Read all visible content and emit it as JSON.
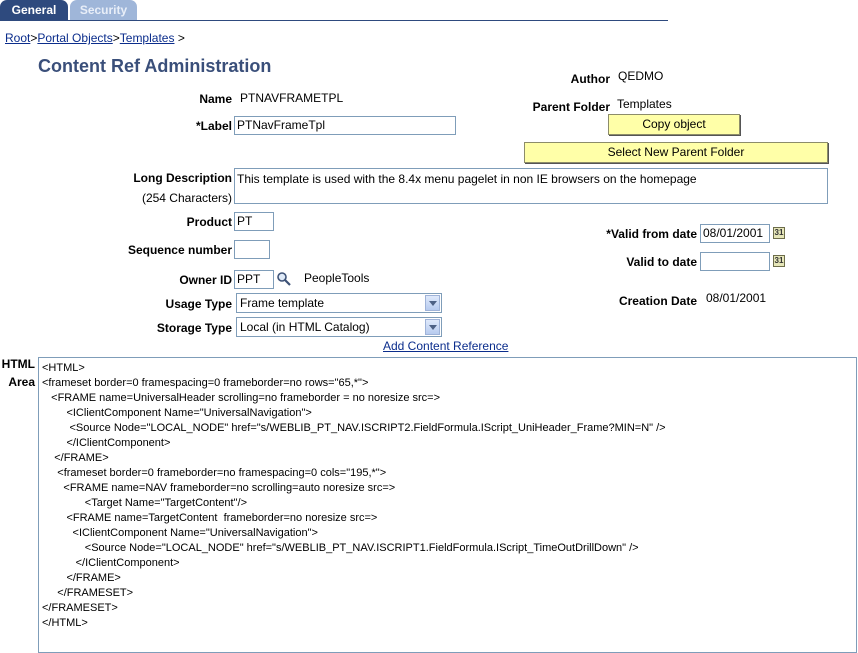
{
  "tabs": [
    {
      "label": "General",
      "active": true
    },
    {
      "label": "Security",
      "active": false
    }
  ],
  "breadcrumb": {
    "items": [
      "Root",
      "Portal Objects",
      "Templates"
    ],
    "separator": ">"
  },
  "page_title": "Content Ref Administration",
  "fields": {
    "name_label": "Name",
    "name_value": "PTNAVFRAMETPL",
    "label_label": "*Label",
    "label_value": "PTNavFrameTpl",
    "author_label": "Author",
    "author_value": "QEDMO",
    "parent_folder_label": "Parent Folder",
    "parent_folder_value": "Templates",
    "long_desc_label": "Long Description",
    "long_desc_hint": "(254 Characters)",
    "long_desc_value": "This template is used with the 8.4x menu pagelet in non IE browsers on the homepage",
    "product_label": "Product",
    "product_value": "PT",
    "sequence_label": "Sequence number",
    "sequence_value": "",
    "owner_label": "Owner ID",
    "owner_value": "PPT",
    "owner_desc": "PeopleTools",
    "usage_label": "Usage Type",
    "usage_value": "Frame template",
    "storage_label": "Storage Type",
    "storage_value": "Local (in HTML Catalog)",
    "valid_from_label": "*Valid from date",
    "valid_from_value": "08/01/2001",
    "valid_to_label": "Valid to date",
    "valid_to_value": "",
    "creation_label": "Creation Date",
    "creation_value": "08/01/2001",
    "html_label_1": "HTML",
    "html_label_2": "Area"
  },
  "buttons": {
    "copy_object": "Copy object",
    "select_parent": "Select New Parent Folder",
    "add_content_ref": "Add Content Reference"
  },
  "html_area_lines": [
    "<HTML>",
    "<frameset border=0 framespacing=0 frameborder=no rows=\"65,*\">",
    "   <FRAME name=UniversalHeader scrolling=no frameborder = no noresize src=>",
    "        <IClientComponent Name=\"UniversalNavigation\">",
    "         <Source Node=\"LOCAL_NODE\" href=\"s/WEBLIB_PT_NAV.ISCRIPT2.FieldFormula.IScript_UniHeader_Frame?MIN=N\" />",
    "        </IClientComponent>",
    "    </FRAME>",
    "     <frameset border=0 frameborder=no framespacing=0 cols=\"195,*\">",
    "       <FRAME name=NAV frameborder=no scrolling=auto noresize src=>",
    "              <Target Name=\"TargetContent\"/>",
    "        <FRAME name=TargetContent  frameborder=no noresize src=>",
    "          <IClientComponent Name=\"UniversalNavigation\">",
    "              <Source Node=\"LOCAL_NODE\" href=\"s/WEBLIB_PT_NAV.ISCRIPT1.FieldFormula.IScript_TimeOutDrillDown\" />",
    "           </IClientComponent>",
    "        </FRAME>",
    "     </FRAMESET>",
    "</FRAMESET>",
    "</HTML>"
  ],
  "colors": {
    "tab_active": "#2e4a7e",
    "tab_inactive": "#9fb6d9",
    "title": "#3a4f7a",
    "link": "#0b2d8c",
    "button_bg": "#ffffa8"
  }
}
